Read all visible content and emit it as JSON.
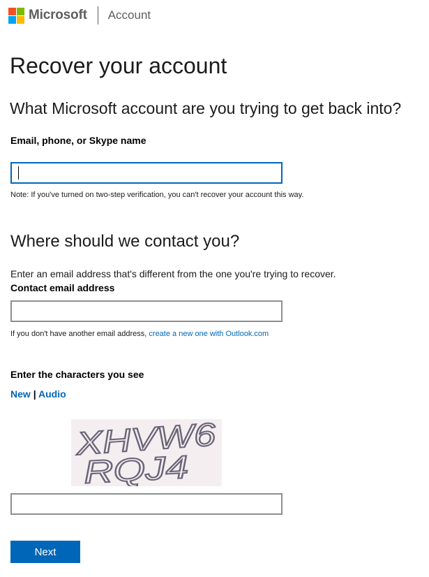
{
  "header": {
    "brand": "Microsoft",
    "section": "Account",
    "logo_colors": [
      "#f25022",
      "#7fba00",
      "#00a4ef",
      "#ffb900"
    ]
  },
  "page_title": "Recover your account",
  "identity": {
    "question": "What Microsoft account are you trying to get back into?",
    "label": "Email, phone, or Skype name",
    "value": "",
    "note": "Note: If you've turned on two-step verification, you can't recover your account this way."
  },
  "contact": {
    "heading": "Where should we contact you?",
    "description": "Enter an email address that's different from the one you're trying to recover.",
    "label": "Contact email address",
    "value": "",
    "help_text": "If you don't have another email address,",
    "help_link": "create a new one with Outlook.com"
  },
  "captcha": {
    "label": "Enter the characters you see",
    "new_link": "New",
    "separator": "|",
    "audio_link": "Audio",
    "line1": "XHVW6",
    "line2": "RQJ4",
    "value": ""
  },
  "next_label": "Next",
  "colors": {
    "accent": "#0067b8",
    "text": "#1b1b1b",
    "muted": "#5e5e5e"
  }
}
